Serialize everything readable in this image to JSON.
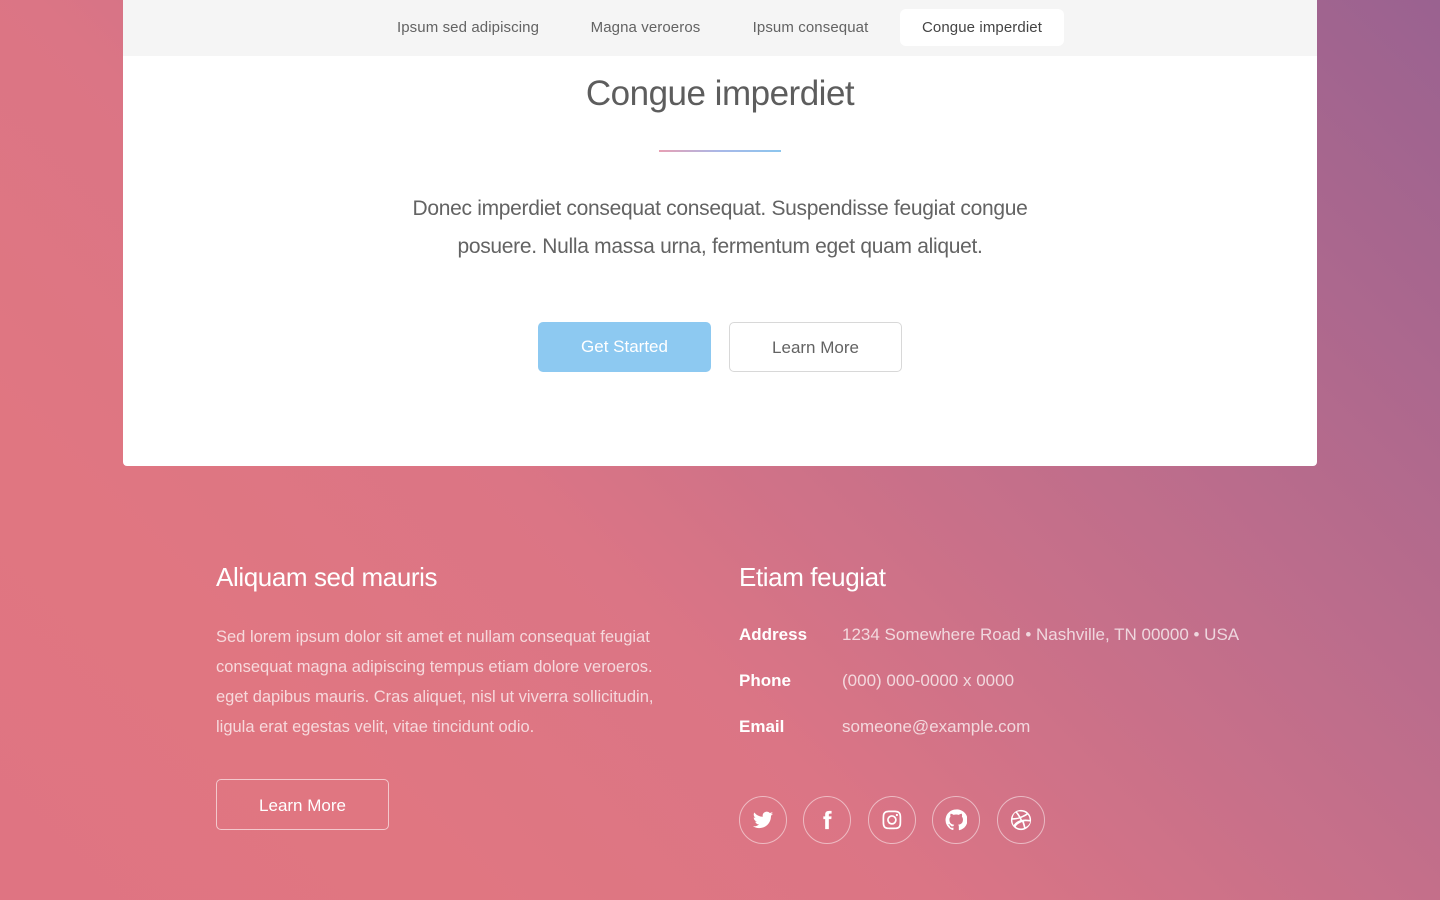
{
  "nav": {
    "tabs": [
      {
        "label": "Ipsum sed adipiscing"
      },
      {
        "label": "Magna veroeros"
      },
      {
        "label": "Ipsum consequat"
      },
      {
        "label": "Congue imperdiet"
      }
    ],
    "active_index": 3
  },
  "main": {
    "title": "Congue imperdiet",
    "description": "Donec imperdiet consequat consequat. Suspendisse feugiat congue posuere. Nulla massa urna, fermentum eget quam aliquet.",
    "primary_button": "Get Started",
    "secondary_button": "Learn More"
  },
  "footer": {
    "left": {
      "heading": "Aliquam sed mauris",
      "text": "Sed lorem ipsum dolor sit amet et nullam consequat feugiat consequat magna adipiscing tempus etiam dolore veroeros. eget dapibus mauris. Cras aliquet, nisl ut viverra sollicitudin, ligula erat egestas velit, vitae tincidunt odio.",
      "button": "Learn More"
    },
    "right": {
      "heading": "Etiam feugiat",
      "contacts": [
        {
          "label": "Address",
          "value": "1234 Somewhere Road • Nashville, TN 00000 • USA"
        },
        {
          "label": "Phone",
          "value": "(000) 000-0000 x 0000"
        },
        {
          "label": "Email",
          "value": "someone@example.com"
        }
      ],
      "social_icons": [
        "twitter-icon",
        "facebook-icon",
        "instagram-icon",
        "github-icon",
        "dribbble-icon"
      ]
    }
  },
  "colors": {
    "accent_blue": "#8dc9f1",
    "gradient_pink": "#e07681",
    "gradient_purple": "#9a6290"
  }
}
